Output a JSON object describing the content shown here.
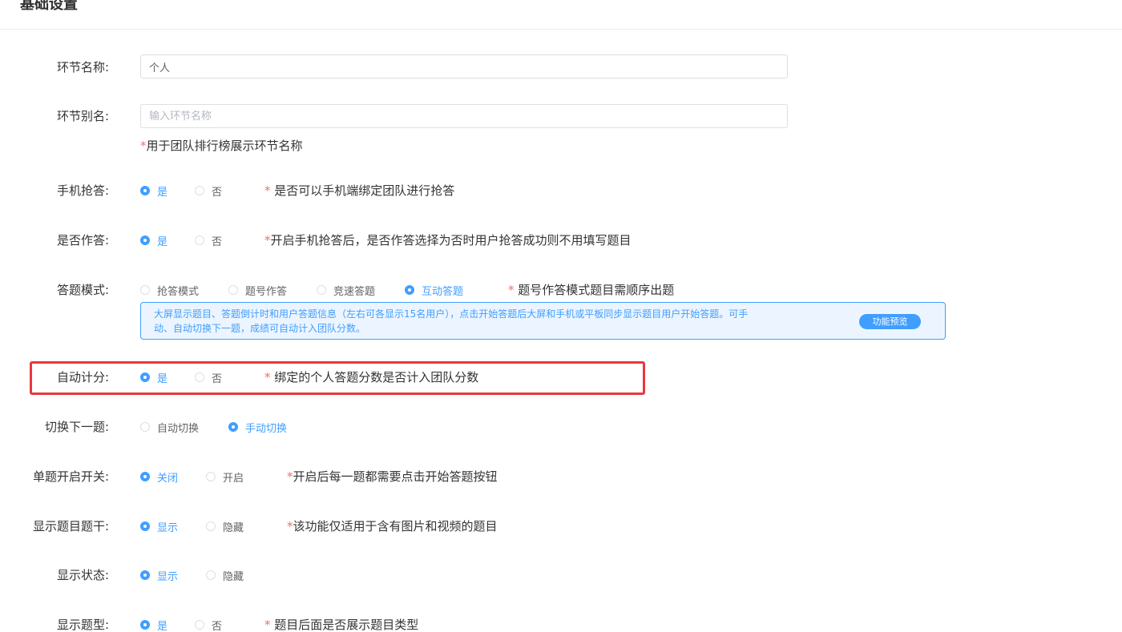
{
  "header": {
    "title": "基础设置"
  },
  "stage_name": {
    "label": "环节名称:",
    "value": "个人"
  },
  "stage_alias": {
    "label": "环节别名:",
    "placeholder": "输入环节名称",
    "hint_star": "*",
    "hint_text": "用于团队排行榜展示环节名称"
  },
  "phone_grab": {
    "label": "手机抢答:",
    "options": [
      "是",
      "否"
    ],
    "selected": "是",
    "hint_star": "*",
    "hint_text": " 是否可以手机端绑定团队进行抢答"
  },
  "need_answer": {
    "label": "是否作答:",
    "options": [
      "是",
      "否"
    ],
    "selected": "是",
    "hint_star": "*",
    "hint_text": "开启手机抢答后，是否作答选择为否时用户抢答成功则不用填写题目"
  },
  "answer_mode": {
    "label": "答题模式:",
    "options": [
      "抢答模式",
      "题号作答",
      "竞速答题",
      "互动答题"
    ],
    "selected": "互动答题",
    "hint_star": "*",
    "hint_text": " 题号作答模式题目需顺序出题",
    "info_line1": "大屏显示题目、答题倒计时和用户答题信息（左右可各显示15名用户），点击开始答题后大屏和手机或平板同步显示题目用户开始答题。可手",
    "info_line2": "动、自动切换下一题，成绩可自动计入团队分数。",
    "preview_label": "功能预览"
  },
  "auto_score": {
    "label": "自动计分:",
    "options": [
      "是",
      "否"
    ],
    "selected": "是",
    "hint_star": "*",
    "hint_text": " 绑定的个人答题分数是否计入团队分数"
  },
  "switch_next": {
    "label": "切换下一题:",
    "options": [
      "自动切换",
      "手动切换"
    ],
    "selected": "手动切换"
  },
  "single_switch": {
    "label": "单题开启开关:",
    "options": [
      "关闭",
      "开启"
    ],
    "selected": "关闭",
    "hint_star": "*",
    "hint_text": "开启后每一题都需要点击开始答题按钮"
  },
  "show_stem": {
    "label": "显示题目题干:",
    "options": [
      "显示",
      "隐藏"
    ],
    "selected": "显示",
    "hint_star": "*",
    "hint_text": "该功能仅适用于含有图片和视频的题目"
  },
  "show_status": {
    "label": "显示状态:",
    "options": [
      "显示",
      "隐藏"
    ],
    "selected": "显示"
  },
  "show_type": {
    "label": "显示题型:",
    "options": [
      "是",
      "否"
    ],
    "selected": "是",
    "hint_star": "*",
    "hint_text": " 题目后面是否展示题目类型"
  },
  "colors": {
    "accent": "#409eff",
    "required": "#f56c6c",
    "highlight": "#e8383d"
  }
}
